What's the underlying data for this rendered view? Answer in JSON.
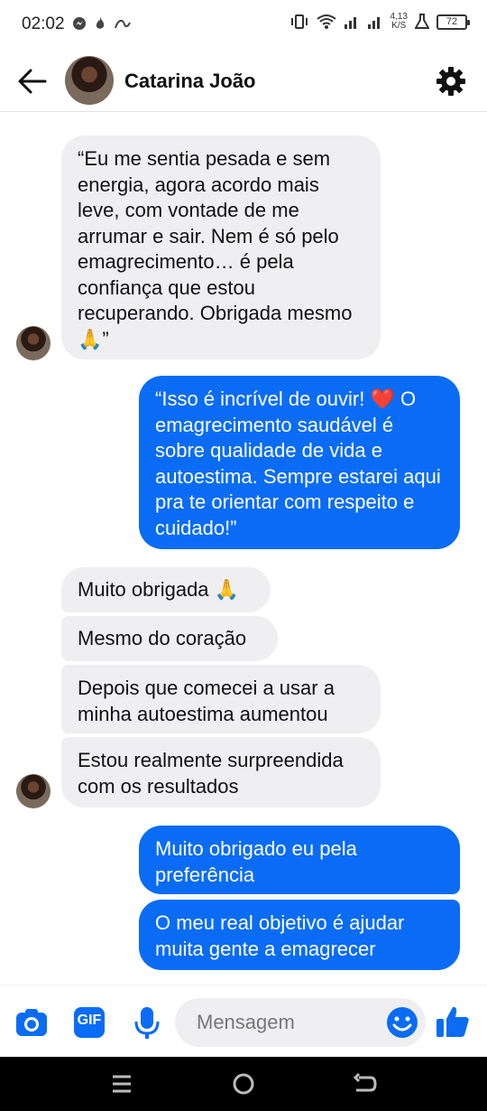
{
  "status_bar": {
    "time": "02:02",
    "net_speed_value": "4,13",
    "net_speed_unit": "K/S",
    "battery": "72"
  },
  "header": {
    "contact_name": "Catarina João"
  },
  "messages": [
    {
      "side": "received",
      "text": "“Eu me sentia pesada e sem energia, agora acordo mais leve, com vontade de me arrumar e sair. Nem é só pelo emagrecimento… é pela confiança que estou recuperando. Obrigada mesmo 🙏”"
    },
    {
      "side": "sent",
      "text": "“Isso é incrível de ouvir!",
      "text_emoji": "❤️",
      "text_rest": "O emagrecimento saudável é sobre qualidade de vida e autoestima. Sempre estarei aqui pra te orientar com respeito e cuidado!”"
    },
    {
      "side": "received",
      "text": "Muito obrigada 🙏"
    },
    {
      "side": "received",
      "text": "Mesmo do coração"
    },
    {
      "side": "received",
      "text": "Depois que comecei a usar a minha autoestima aumentou"
    },
    {
      "side": "received",
      "text": "Estou realmente surpreendida com os resultados"
    },
    {
      "side": "sent",
      "text": "Muito obrigado eu pela preferência"
    },
    {
      "side": "sent",
      "text": "O meu real objetivo é ajudar muita gente a emagrecer"
    }
  ],
  "composer": {
    "placeholder": "Mensagem",
    "gif_label": "GIF"
  },
  "colors": {
    "accent": "#0a6cf5",
    "received_bubble": "#efeff2"
  },
  "icons": {
    "back": "arrow-left-icon",
    "settings": "gear-icon",
    "camera": "camera-icon",
    "gif": "gif-icon",
    "mic": "microphone-icon",
    "emoji": "smiley-icon",
    "like": "thumbs-up-icon"
  }
}
